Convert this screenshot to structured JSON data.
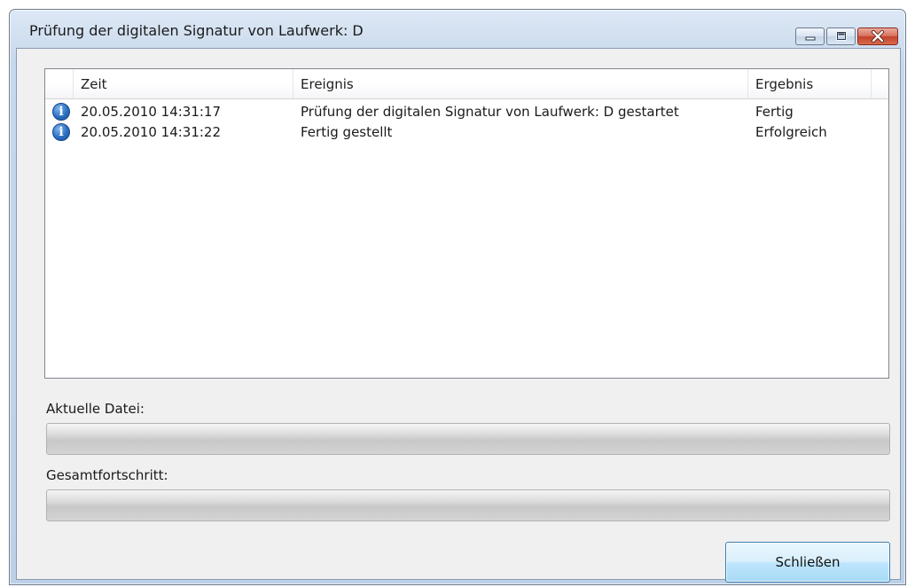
{
  "window": {
    "title": "Prüfung der digitalen Signatur von Laufwerk: D"
  },
  "log": {
    "columns": {
      "time": "Zeit",
      "event": "Ereignis",
      "result": "Ergebnis"
    },
    "rows": [
      {
        "icon": "info-icon",
        "time": "20.05.2010 14:31:17",
        "event": "Prüfung der digitalen Signatur von Laufwerk: D gestartet",
        "result": "Fertig"
      },
      {
        "icon": "info-icon",
        "time": "20.05.2010 14:31:22",
        "event": "Fertig gestellt",
        "result": "Erfolgreich"
      }
    ]
  },
  "current_file": {
    "label": "Aktuelle Datei:",
    "progress": 0
  },
  "overall": {
    "label": "Gesamtfortschritt:",
    "progress": 0
  },
  "close_button": {
    "label": "Schließen"
  }
}
